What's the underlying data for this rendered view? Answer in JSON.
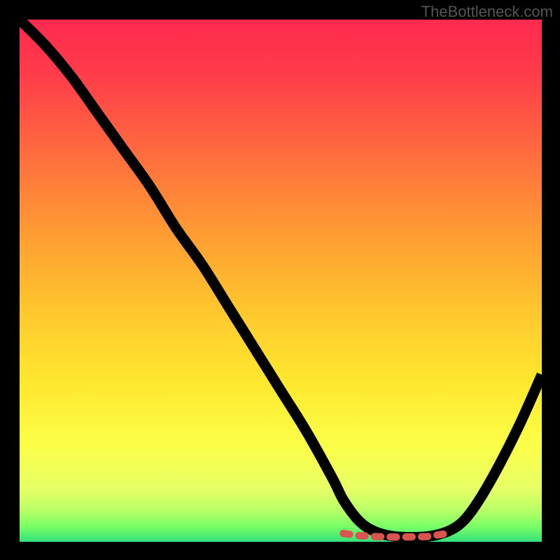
{
  "watermark": "TheBottleneck.com",
  "chart_data": {
    "type": "line",
    "title": "",
    "xlabel": "",
    "ylabel": "",
    "xlim": [
      0,
      100
    ],
    "ylim": [
      0,
      100
    ],
    "series": [
      {
        "name": "bottleneck-curve",
        "x": [
          0,
          5,
          10,
          15,
          20,
          25,
          30,
          35,
          40,
          45,
          50,
          55,
          60,
          62,
          65,
          68,
          72,
          78,
          82,
          85,
          88,
          92,
          96,
          100
        ],
        "y": [
          100,
          95,
          89,
          82,
          75,
          68,
          60,
          53,
          45,
          37,
          29,
          21,
          12,
          8,
          4,
          2,
          1,
          1,
          2,
          4,
          8,
          15,
          23,
          32
        ]
      }
    ],
    "highlight_segment": {
      "name": "flat-zone",
      "color": "#d9534f",
      "x": [
        62,
        65,
        68,
        72,
        78,
        82
      ],
      "y": [
        1.6,
        1.2,
        1.0,
        0.9,
        1.0,
        1.6
      ]
    },
    "background_gradient": {
      "stops": [
        {
          "offset": 0.0,
          "color": "#ff2a4f"
        },
        {
          "offset": 0.1,
          "color": "#ff3b4a"
        },
        {
          "offset": 0.25,
          "color": "#ff6a3f"
        },
        {
          "offset": 0.4,
          "color": "#ff9933"
        },
        {
          "offset": 0.55,
          "color": "#ffc52e"
        },
        {
          "offset": 0.7,
          "color": "#ffe92e"
        },
        {
          "offset": 0.82,
          "color": "#fbff4a"
        },
        {
          "offset": 0.9,
          "color": "#e6ff66"
        },
        {
          "offset": 0.94,
          "color": "#b8ff66"
        },
        {
          "offset": 0.97,
          "color": "#7dff66"
        },
        {
          "offset": 1.0,
          "color": "#33e07a"
        }
      ]
    }
  }
}
